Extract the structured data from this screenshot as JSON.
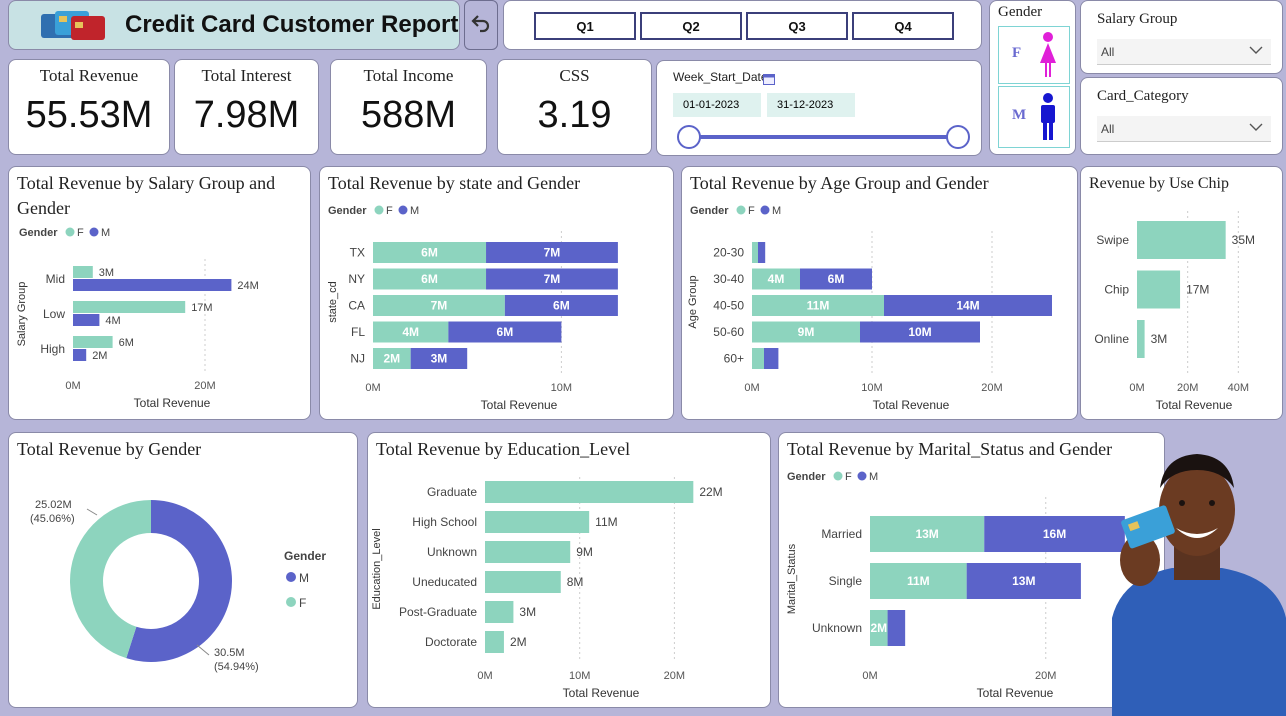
{
  "header": {
    "title": "Credit Card Customer Report",
    "quarters": [
      "Q1",
      "Q2",
      "Q3",
      "Q4"
    ]
  },
  "slicers": {
    "gender": {
      "title": "Gender",
      "options": [
        "F",
        "M"
      ]
    },
    "salary_group": {
      "title": "Salary Group",
      "value": "All"
    },
    "card_category": {
      "title": "Card_Category",
      "value": "All"
    },
    "date": {
      "title": "Week_Start_Date",
      "start": "01-01-2023",
      "end": "31-12-2023"
    }
  },
  "kpis": [
    {
      "label": "Total Revenue",
      "value": "55.53M"
    },
    {
      "label": "Total Interest",
      "value": "7.98M"
    },
    {
      "label": "Total Income",
      "value": "588M"
    },
    {
      "label": "CSS",
      "value": "3.19"
    }
  ],
  "colors": {
    "F": "#8dd4be",
    "M": "#5b63c9",
    "background": "#b6b5d8",
    "header": "#c8e2e4"
  },
  "icons": [
    "credit-card-icon",
    "back-arrow-icon",
    "calendar-icon",
    "female-icon",
    "male-icon",
    "chevron-down-icon"
  ],
  "chart_data": [
    {
      "type": "bar",
      "title": "Total Revenue by Salary Group and Gender",
      "legend_title": "Gender",
      "orientation": "horizontal-clustered",
      "categories": [
        "Mid",
        "Low",
        "High"
      ],
      "series": [
        {
          "name": "F",
          "values": [
            3,
            17,
            6
          ],
          "labels": [
            "3M",
            "17M",
            "6M"
          ]
        },
        {
          "name": "M",
          "values": [
            24,
            4,
            2
          ],
          "labels": [
            "24M",
            "4M",
            "2M"
          ]
        }
      ],
      "xlabel": "Total Revenue",
      "ylabel": "Salary Group",
      "xticks": [
        "0M",
        "20M"
      ],
      "xlim": [
        0,
        30
      ]
    },
    {
      "type": "bar",
      "title": "Total Revenue by state and Gender",
      "legend_title": "Gender",
      "orientation": "horizontal-stacked",
      "categories": [
        "TX",
        "NY",
        "CA",
        "FL",
        "NJ"
      ],
      "series": [
        {
          "name": "F",
          "values": [
            6,
            6,
            7,
            4,
            2
          ],
          "labels": [
            "6M",
            "6M",
            "7M",
            "4M",
            "2M"
          ]
        },
        {
          "name": "M",
          "values": [
            7,
            7,
            6,
            6,
            3
          ],
          "labels": [
            "7M",
            "7M",
            "6M",
            "6M",
            "3M"
          ]
        }
      ],
      "xlabel": "Total Revenue",
      "ylabel": "state_cd",
      "xticks": [
        "0M",
        "10M"
      ],
      "xlim": [
        0,
        15.5
      ]
    },
    {
      "type": "bar",
      "title": "Total Revenue by Age Group and Gender",
      "legend_title": "Gender",
      "orientation": "horizontal-stacked",
      "categories": [
        "20-30",
        "30-40",
        "40-50",
        "50-60",
        "60+"
      ],
      "series": [
        {
          "name": "F",
          "values": [
            0.5,
            4,
            11,
            9,
            1
          ],
          "labels": [
            "",
            "4M",
            "11M",
            "9M",
            ""
          ]
        },
        {
          "name": "M",
          "values": [
            0.6,
            6,
            14,
            10,
            1.2
          ],
          "labels": [
            "",
            "6M",
            "14M",
            "10M",
            ""
          ]
        }
      ],
      "xlabel": "Total Revenue",
      "ylabel": "Age Group",
      "xticks": [
        "0M",
        "10M",
        "20M"
      ],
      "xlim": [
        0,
        26.5
      ]
    },
    {
      "type": "bar",
      "title": "Revenue by Use Chip",
      "orientation": "horizontal",
      "categories": [
        "Swipe",
        "Chip",
        "Online"
      ],
      "values": [
        35,
        17,
        3
      ],
      "labels": [
        "35M",
        "17M",
        "3M"
      ],
      "xlabel": "Total Revenue",
      "xticks": [
        "0M",
        "20M",
        "40M"
      ],
      "xlim": [
        0,
        45
      ]
    },
    {
      "type": "pie",
      "title": "Total Revenue by Gender",
      "legend_title": "Gender",
      "slices": [
        {
          "name": "M",
          "value": 30.5,
          "label": "30.5M",
          "percent": "(54.94%)"
        },
        {
          "name": "F",
          "value": 25.02,
          "label": "25.02M",
          "percent": "(45.06%)"
        }
      ]
    },
    {
      "type": "bar",
      "title": "Total Revenue by Education_Level",
      "orientation": "horizontal",
      "categories": [
        "Graduate",
        "High School",
        "Unknown",
        "Uneducated",
        "Post-Graduate",
        "Doctorate"
      ],
      "values": [
        22,
        11,
        9,
        8,
        3,
        2
      ],
      "labels": [
        "22M",
        "11M",
        "9M",
        "8M",
        "3M",
        "2M"
      ],
      "xlabel": "Total Revenue",
      "ylabel": "Education_Level",
      "xticks": [
        "0M",
        "10M",
        "20M"
      ],
      "xlim": [
        0,
        24.5
      ]
    },
    {
      "type": "bar",
      "title": "Total Revenue by Marital_Status and Gender",
      "legend_title": "Gender",
      "orientation": "horizontal-stacked",
      "categories": [
        "Married",
        "Single",
        "Unknown"
      ],
      "series": [
        {
          "name": "F",
          "values": [
            13,
            11,
            2
          ],
          "labels": [
            "13M",
            "11M",
            "2M"
          ]
        },
        {
          "name": "M",
          "values": [
            16,
            13,
            2
          ],
          "labels": [
            "16M",
            "13M",
            ""
          ]
        }
      ],
      "xlabel": "Total Revenue",
      "ylabel": "Marital_Status",
      "xticks": [
        "0M",
        "20M"
      ],
      "xlim": [
        0,
        33
      ]
    }
  ]
}
